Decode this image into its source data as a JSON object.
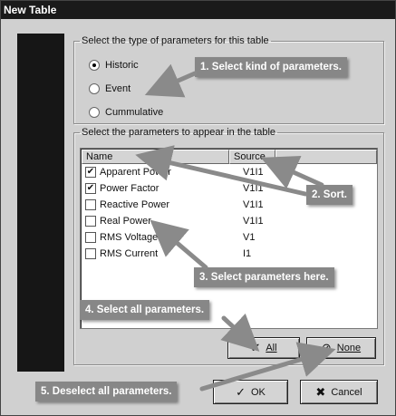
{
  "window": {
    "title": "New Table"
  },
  "type_group": {
    "legend": "Select the type of parameters for this table",
    "options": [
      {
        "label": "Historic",
        "selected": true
      },
      {
        "label": "Event",
        "selected": false
      },
      {
        "label": "Cummulative",
        "selected": false
      }
    ]
  },
  "params_group": {
    "legend": "Select the parameters to appear in the table",
    "columns": {
      "name": "Name",
      "source": "Source"
    },
    "rows": [
      {
        "name": "Apparent Power",
        "source": "V1I1",
        "checked": true
      },
      {
        "name": "Power Factor",
        "source": "V1I1",
        "checked": true
      },
      {
        "name": "Reactive Power",
        "source": "V1I1",
        "checked": false
      },
      {
        "name": "Real Power",
        "source": "V1I1",
        "checked": false
      },
      {
        "name": "RMS Voltage",
        "source": "V1",
        "checked": false
      },
      {
        "name": "RMS Current",
        "source": "I1",
        "checked": false
      }
    ],
    "check_mark": "✔",
    "all_button": "All",
    "none_button": "None"
  },
  "footer": {
    "ok_button": "OK",
    "cancel_button": "Cancel"
  },
  "callouts": {
    "c1": "1. Select kind of parameters.",
    "c2": "2. Sort.",
    "c3": "3. Select parameters here.",
    "c4": "4. Select all parameters.",
    "c5": "5. Deselect all parameters."
  },
  "icons": {
    "all": "checkmarks-icon",
    "none": "no-entry-icon",
    "ok": "check-icon",
    "cancel": "x-icon"
  },
  "colors": {
    "titlebar": "#1a1a1a",
    "dialog": "#d0d0d0",
    "callout": "#878787",
    "side_panel": "#161616"
  }
}
